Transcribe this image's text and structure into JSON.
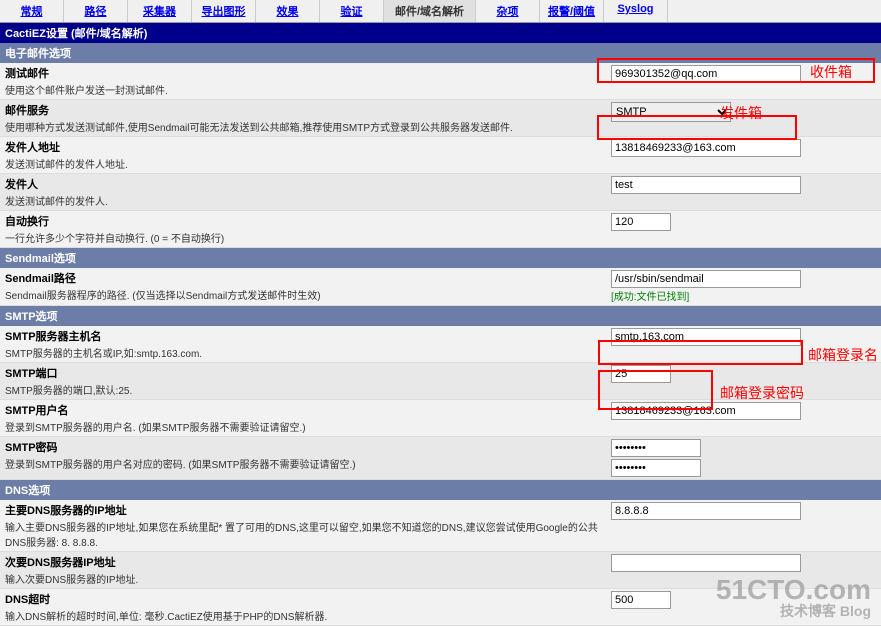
{
  "tabs": [
    "常规",
    "路径",
    "采集器",
    "导出图形",
    "效果",
    "验证",
    "邮件/域名解析",
    "杂项",
    "报警/阈值",
    "Syslog"
  ],
  "activeTab": 6,
  "main_header": "CactiEZ设置 (邮件/域名解析)",
  "sections": {
    "email_options": "电子邮件选项",
    "sendmail_options": "Sendmail选项",
    "smtp_options": "SMTP选项",
    "dns_options": "DNS选项"
  },
  "fields": {
    "test_mail": {
      "title": "测试邮件",
      "desc": "使用这个邮件账户发送一封测试邮件.",
      "value": "969301352@qq.com"
    },
    "mail_service": {
      "title": "邮件服务",
      "desc": "使用哪种方式发送测试邮件,使用Sendmail可能无法发送到公共邮箱,推荐使用SMTP方式登录到公共服务器发送邮件.",
      "value": "SMTP"
    },
    "sender_addr": {
      "title": "发件人地址",
      "desc": "发送测试邮件的发件人地址.",
      "value": "13818469233@163.com"
    },
    "sender": {
      "title": "发件人",
      "desc": "发送测试邮件的发件人.",
      "value": "test"
    },
    "auto_wrap": {
      "title": "自动换行",
      "desc": "一行允许多少个字符并自动换行. (0 = 不自动换行)",
      "value": "120"
    },
    "sendmail_path": {
      "title": "Sendmail路径",
      "desc": "Sendmail服务器程序的路径. (仅当选择以Sendmail方式发送邮件时生效)",
      "value": "/usr/sbin/sendmail",
      "success": "[成功:文件已找到]"
    },
    "smtp_host": {
      "title": "SMTP服务器主机名",
      "desc": "SMTP服务器的主机名或IP,如:smtp.163.com.",
      "value": "smtp.163.com"
    },
    "smtp_port": {
      "title": "SMTP端口",
      "desc": "SMTP服务器的端口,默认:25.",
      "value": "25"
    },
    "smtp_user": {
      "title": "SMTP用户名",
      "desc": "登录到SMTP服务器的用户名. (如果SMTP服务器不需要验证请留空.)",
      "value": "13818469233@163.com"
    },
    "smtp_pass": {
      "title": "SMTP密码",
      "desc": "登录到SMTP服务器的用户名对应的密码. (如果SMTP服务器不需要验证请留空.)",
      "value": "••••••••",
      "confirm": "••••••••"
    },
    "dns_primary": {
      "title": "主要DNS服务器的IP地址",
      "desc": "输入主要DNS服务器的IP地址,如果您在系统里配* 置了可用的DNS,这里可以留空,如果您不知道您的DNS,建议您尝试使用Google的公共DNS服务器: 8. 8.8.8.",
      "value": "8.8.8.8"
    },
    "dns_secondary": {
      "title": "次要DNS服务器IP地址",
      "desc": "输入次要DNS服务器的IP地址.",
      "value": ""
    },
    "dns_timeout": {
      "title": "DNS超时",
      "desc": "输入DNS解析的超时时间,单位: 毫秒.CactiEZ使用基于PHP的DNS解析器.",
      "value": "500"
    }
  },
  "annotations": {
    "recipient": "收件箱",
    "sender": "发件箱",
    "login_name": "邮箱登录名",
    "login_pass": "邮箱登录密码"
  },
  "watermark": {
    "main": "51CTO.com",
    "sub": "技术博客      Blog"
  }
}
